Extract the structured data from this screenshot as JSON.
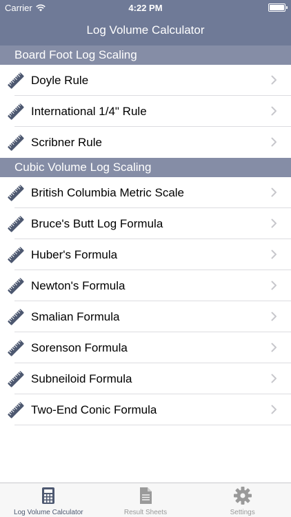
{
  "status_bar": {
    "carrier": "Carrier",
    "time": "4:22 PM"
  },
  "nav": {
    "title": "Log Volume Calculator"
  },
  "sections": [
    {
      "header": "Board Foot Log Scaling",
      "items": [
        {
          "label": "Doyle Rule",
          "icon": "ruler-icon"
        },
        {
          "label": "International 1/4\" Rule",
          "icon": "ruler-icon"
        },
        {
          "label": "Scribner Rule",
          "icon": "ruler-icon"
        }
      ]
    },
    {
      "header": "Cubic Volume Log Scaling",
      "items": [
        {
          "label": "British Columbia Metric Scale",
          "icon": "ruler-icon"
        },
        {
          "label": "Bruce's Butt Log Formula",
          "icon": "ruler-icon"
        },
        {
          "label": "Huber's Formula",
          "icon": "ruler-icon"
        },
        {
          "label": "Newton's Formula",
          "icon": "ruler-icon"
        },
        {
          "label": "Smalian Formula",
          "icon": "ruler-icon"
        },
        {
          "label": "Sorenson Formula",
          "icon": "ruler-icon"
        },
        {
          "label": "Subneiloid Formula",
          "icon": "ruler-icon"
        },
        {
          "label": "Two-End Conic Formula",
          "icon": "ruler-icon"
        }
      ]
    }
  ],
  "tabs": [
    {
      "label": "Log Volume Calculator",
      "icon": "calculator-icon",
      "active": true
    },
    {
      "label": "Result Sheets",
      "icon": "document-icon",
      "active": false
    },
    {
      "label": "Settings",
      "icon": "gear-icon",
      "active": false
    }
  ],
  "colors": {
    "nav_bg": "#6f7a97",
    "section_bg": "#858da6",
    "icon": "#4d5870"
  }
}
